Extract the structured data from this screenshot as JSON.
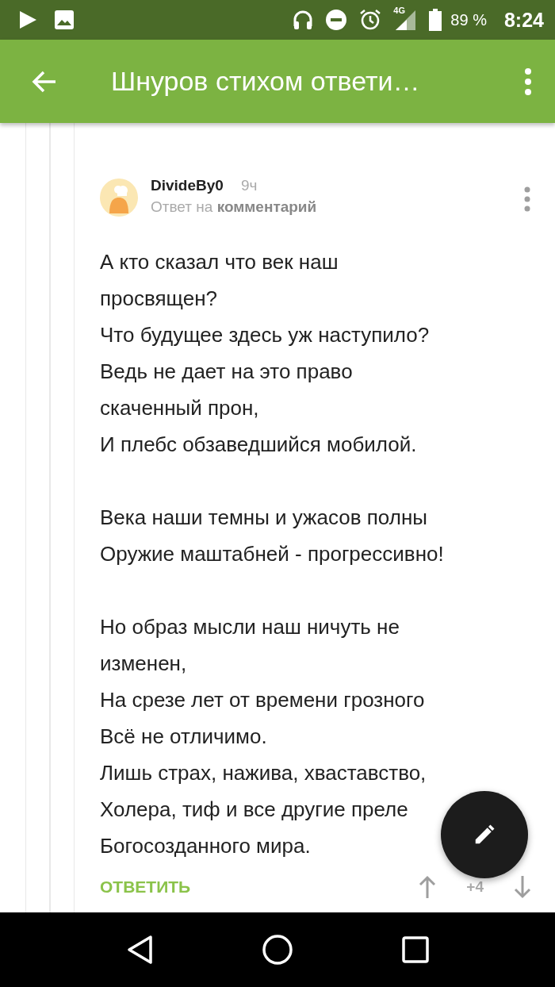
{
  "status_bar": {
    "battery": "89 %",
    "time": "8:24",
    "network": "4G"
  },
  "app_bar": {
    "title": "Шнуров стихом ответи…"
  },
  "comment": {
    "author": "DivideBy0",
    "time": "9ч",
    "reply_to": "Ответ на **комментарий**",
    "stanzas": [
      [
        "А кто сказал что век наш",
        "просвящен?",
        "Что будущее здесь уж наступило?",
        "Ведь не дает на это право",
        "скаченный прон,",
        "И плебс обзаведшийся мобилой."
      ],
      [
        "Века наши темны и ужасов полны",
        "Оружие маштабней - прогрессивно!"
      ],
      [
        "Но образ мысли наш ничуть не",
        "изменен,",
        "На срезе лет от времени грозного",
        "Всё не отличимо.",
        "Лишь страх, нажива, хваставство,",
        "Холера, тиф и все другие преле",
        "Богосозданного мира."
      ]
    ],
    "reply_label": "ОТВЕТИТЬ",
    "score": "+4"
  }
}
